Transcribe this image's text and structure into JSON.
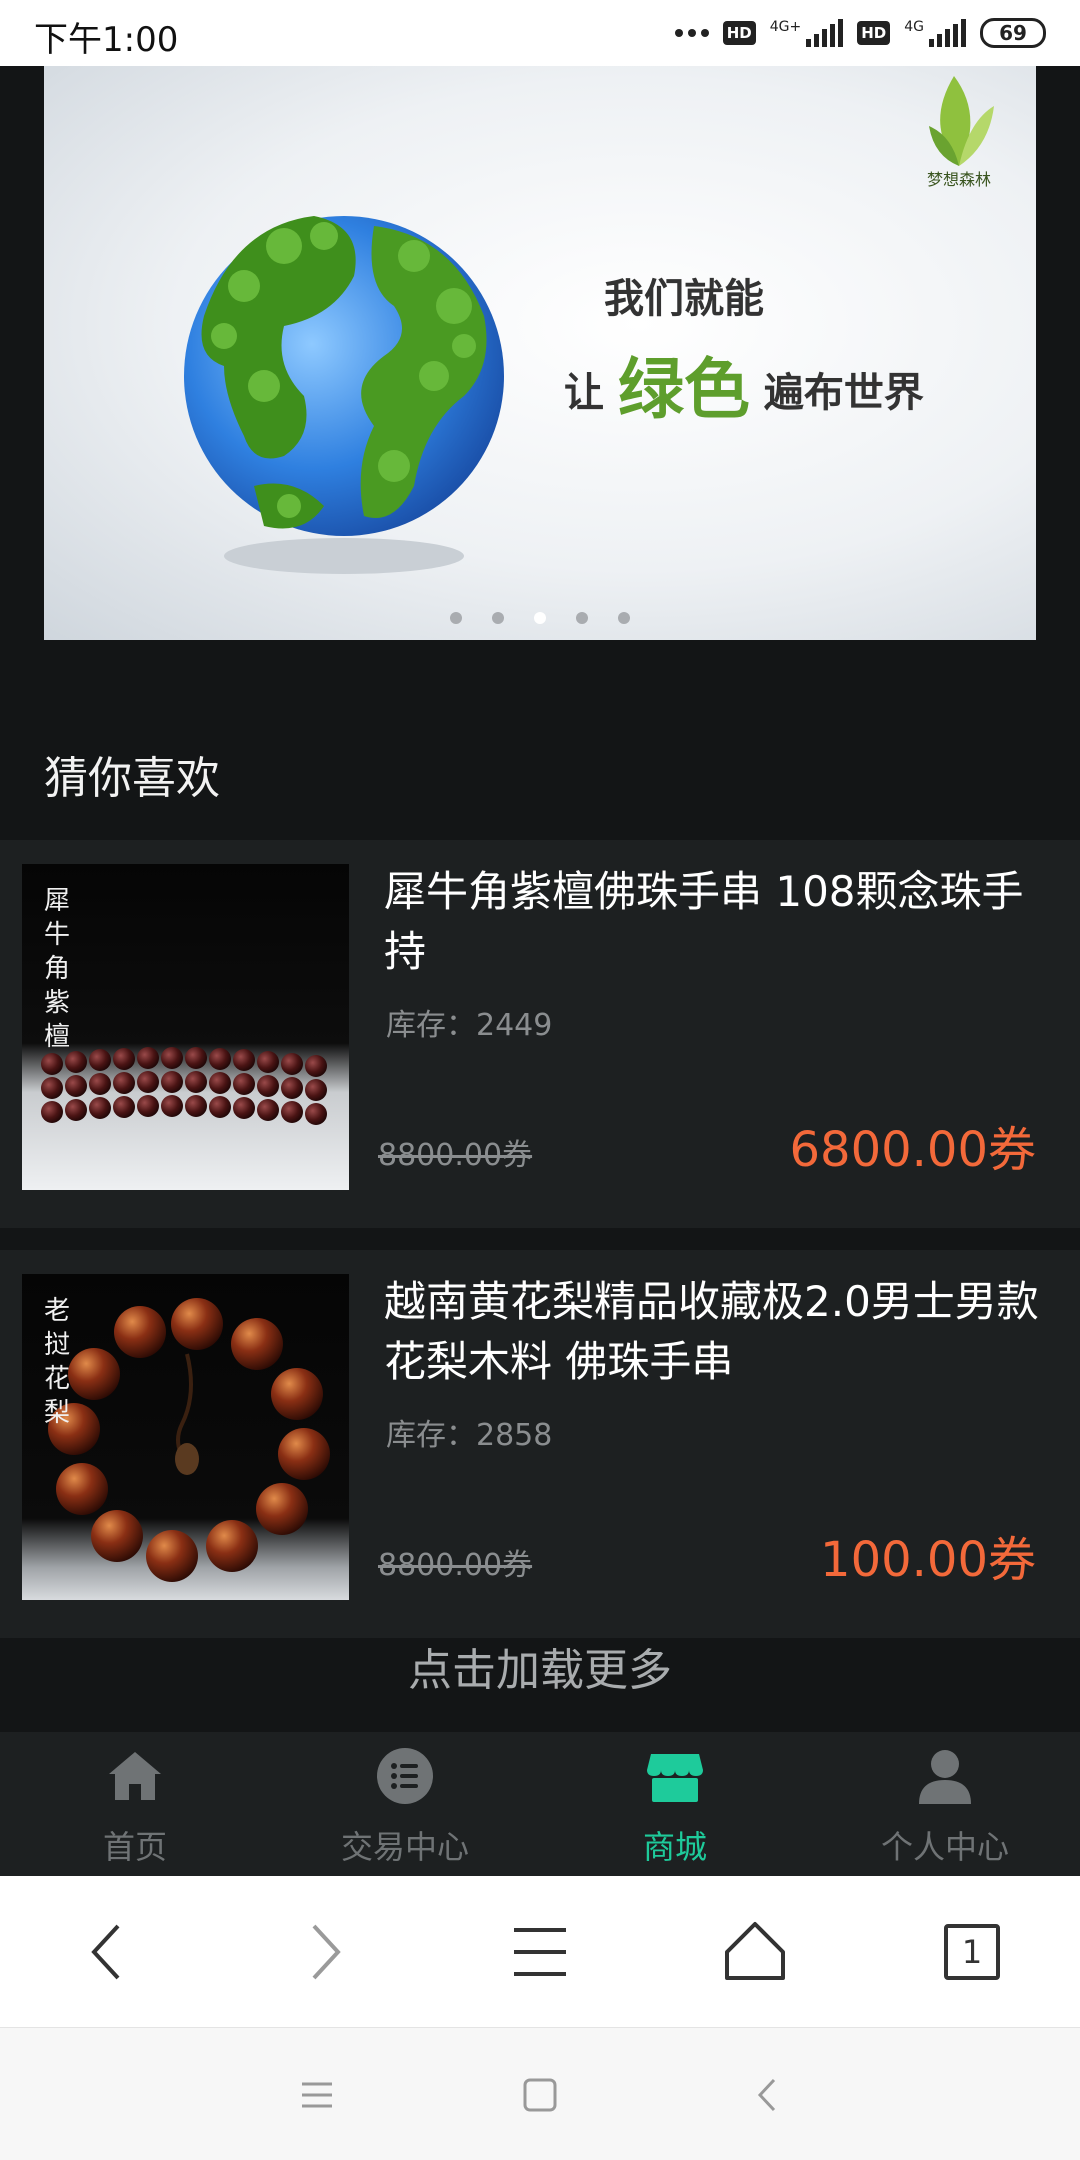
{
  "status_bar": {
    "time": "下午1:00",
    "hd1": "HD",
    "net1": "4G+",
    "hd2": "HD",
    "net2": "4G",
    "battery": "69"
  },
  "banner": {
    "logo_text": "梦想森林",
    "slogan_line1": "我们就能",
    "slogan_line2_prefix": "让",
    "slogan_line2_highlight": "绿色",
    "slogan_line2_suffix": "遍布世界",
    "slide_count": 5,
    "active_slide": 3
  },
  "section": {
    "title": "猜你喜欢"
  },
  "products": [
    {
      "image_text": "犀牛角紫檀",
      "name": "犀牛角紫檀佛珠手串 108颗念珠手持",
      "stock": "库存：2449",
      "old_price": "8800.00券",
      "price": "6800.00券"
    },
    {
      "image_text": "老挝花梨",
      "name": "越南黄花梨精品收藏极2.0男士男款花梨木料 佛珠手串",
      "stock": "库存：2858",
      "old_price": "8800.00券",
      "price": "100.00券"
    }
  ],
  "load_more": "点击加载更多",
  "tabbar": {
    "tabs": [
      {
        "label": "首页",
        "icon": "home-icon",
        "active": false
      },
      {
        "label": "交易中心",
        "icon": "list-icon",
        "active": false
      },
      {
        "label": "商城",
        "icon": "store-icon",
        "active": true
      },
      {
        "label": "个人中心",
        "icon": "user-icon",
        "active": false
      }
    ]
  },
  "browser_bar": {
    "tab_count": "1"
  },
  "colors": {
    "background": "#131516",
    "card": "#1d2021",
    "price": "#f3693a",
    "active_tab": "#1ecb9b",
    "inactive_tab": "#6f7375"
  }
}
